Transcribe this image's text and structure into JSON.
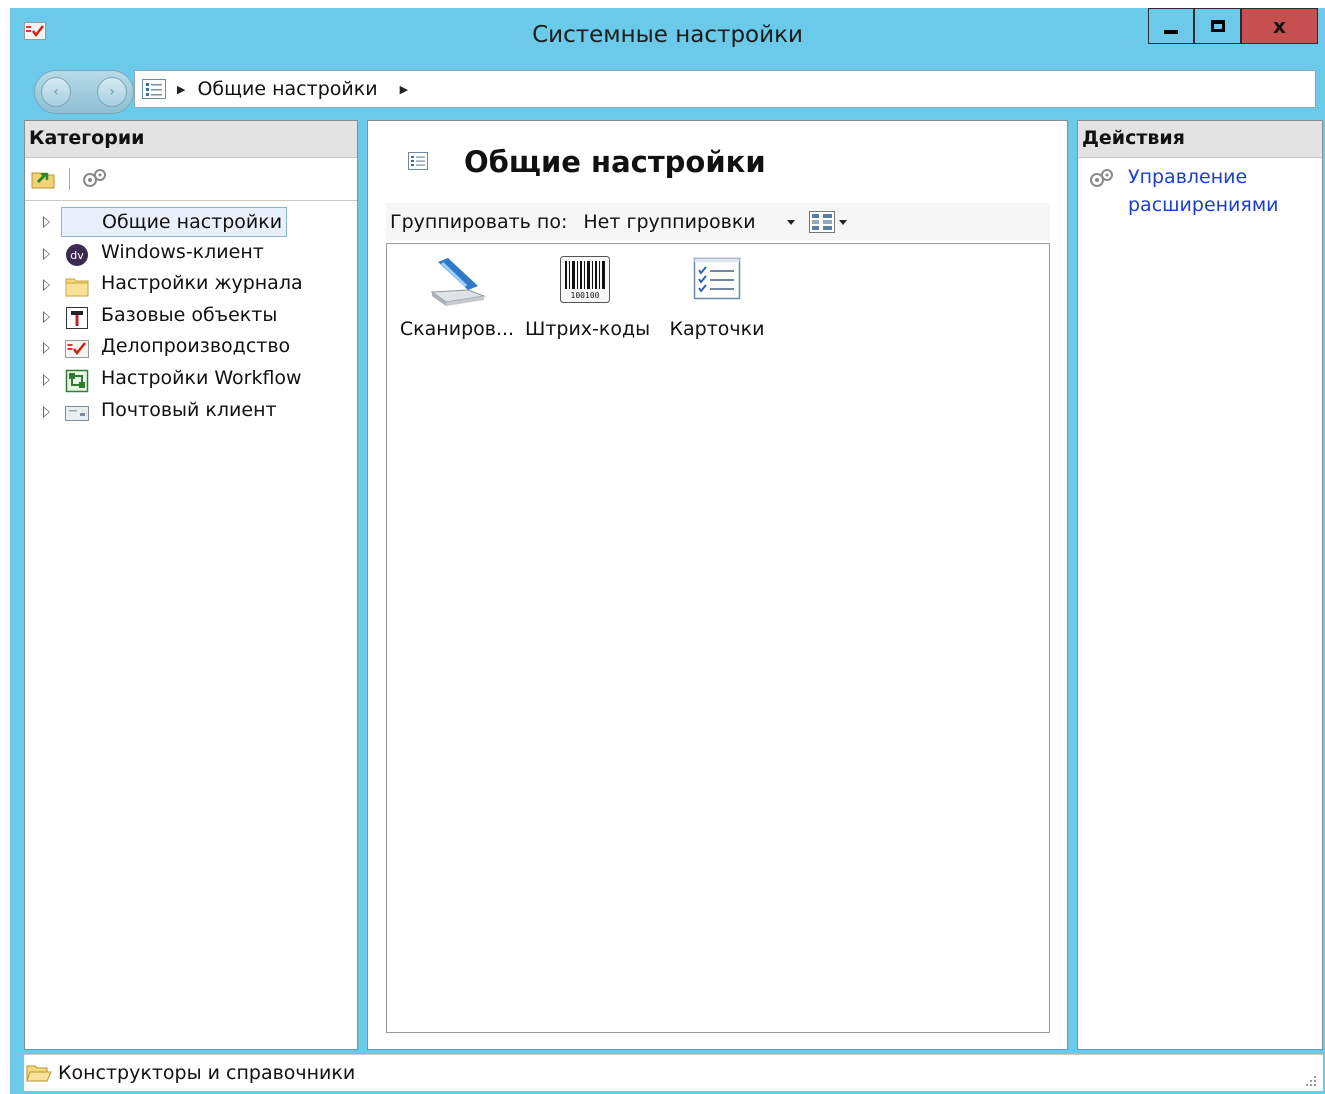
{
  "window": {
    "title": "Системные настройки",
    "close_label": "x"
  },
  "navbar": {
    "back_glyph": "‹",
    "forward_glyph": "›",
    "breadcrumb": [
      "Общие настройки"
    ]
  },
  "categories": {
    "header": "Категории",
    "items": [
      {
        "label": "Общие настройки",
        "icon": "list-icon",
        "selected": true
      },
      {
        "label": "Windows-клиент",
        "icon": "dv-icon"
      },
      {
        "label": "Настройки журнала",
        "icon": "folder-icon"
      },
      {
        "label": "Базовые объекты",
        "icon": "tools-icon"
      },
      {
        "label": "Делопроизводство",
        "icon": "checkbox-doc-icon"
      },
      {
        "label": "Настройки Workflow",
        "icon": "workflow-icon"
      },
      {
        "label": "Почтовый клиент",
        "icon": "mail-icon"
      }
    ]
  },
  "center": {
    "title": "Общие настройки",
    "group_label": "Группировать по:",
    "group_value": "Нет группировки",
    "items": [
      {
        "label": "Сканиров...",
        "icon": "scanner-icon"
      },
      {
        "label": "Штрих-коды",
        "icon": "barcode-icon",
        "barcode_text": "100100"
      },
      {
        "label": "Карточки",
        "icon": "cards-icon"
      }
    ]
  },
  "actions": {
    "header": "Действия",
    "items": [
      {
        "label": "Управление расширениями",
        "icon": "gears-icon"
      }
    ]
  },
  "status": {
    "text": "Конструкторы и справочники"
  },
  "colors": {
    "frame": "#6bcaea",
    "close_button": "#c74f4f",
    "link": "#1a3fd0",
    "selection": "#e8f1fb"
  }
}
